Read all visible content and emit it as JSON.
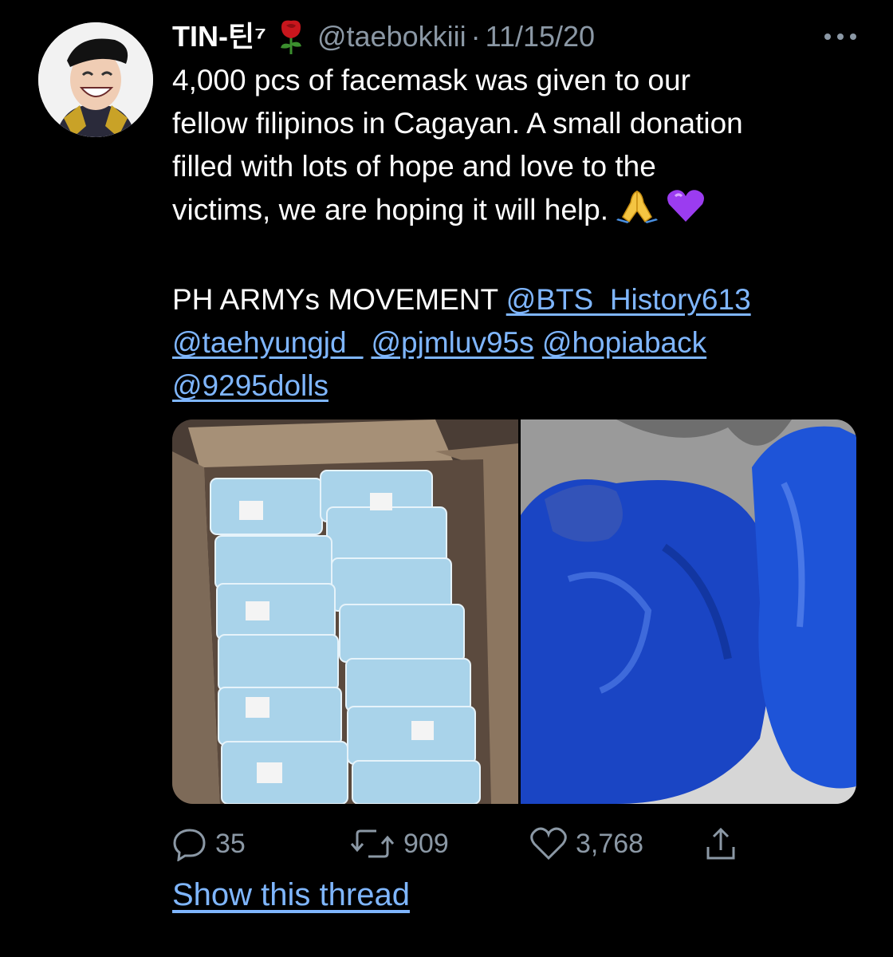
{
  "tweet": {
    "display_name": "TIN-틴⁷",
    "handle": "@taebokkiii",
    "separator": "·",
    "date": "11/15/20",
    "text_lines": [
      "4,000 pcs of facemask was given to our",
      "fellow filipinos in Cagayan. A small donation",
      "filled with lots of hope and love to the",
      "victims, we are hoping it will help."
    ],
    "movement_label": "PH ARMYs MOVEMENT",
    "mentions": [
      "@BTS_History613",
      "@taehyungjd_",
      "@pjmluv95s",
      "@hopiaback",
      "@9295dolls"
    ]
  },
  "stats": {
    "replies": "35",
    "retweets": "909",
    "likes": "3,768"
  },
  "show_thread_label": "Show this thread",
  "icons": {
    "more": "more-dots-icon",
    "rose": "rose-emoji",
    "pray": "folded-hands-emoji",
    "heart": "purple-heart-emoji",
    "reply": "reply-icon",
    "retweet": "retweet-icon",
    "like": "like-icon",
    "share": "share-icon"
  },
  "colors": {
    "background": "#000000",
    "text": "#ffffff",
    "secondary": "#8b98a5",
    "link": "#7fb6ff",
    "purple_heart": "#9b3cf0"
  }
}
